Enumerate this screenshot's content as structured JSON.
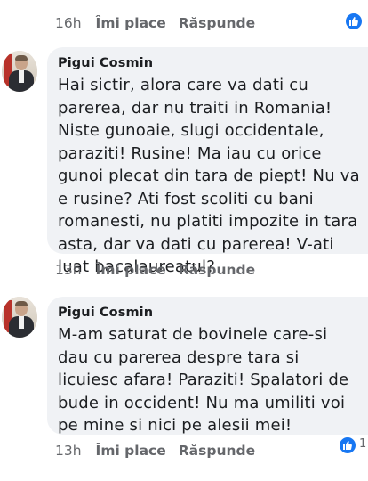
{
  "top_actions": {
    "time": "16h",
    "like": "Îmi place",
    "reply": "Răspunde"
  },
  "comments": [
    {
      "author": "Pigui Cosmin",
      "text": "Hai sictir, alora care va dati cu parerea, dar nu traiti in Romania! Niste gunoaie, slugi occidentale, paraziti! Rusine! Ma iau cu orice gunoi plecat din tara de piept! Nu va e rusine? Ati fost scoliti cu bani romanesti, nu platiti impozite in tara asta, dar va dati cu parerea! V-ati luat bacalaureatul?",
      "time": "13h",
      "like": "Îmi place",
      "reply": "Răspunde"
    },
    {
      "author": "Pigui Cosmin",
      "text": "M-am saturat de bovinele care-si dau cu parerea despre tara si licuiesc afara! Paraziti! Spalatori de bude in occident! Nu ma umiliti voi pe mine si nici pe alesii mei!",
      "time": "13h",
      "like": "Îmi place",
      "reply": "Răspunde",
      "reaction_count": "1"
    }
  ],
  "colors": {
    "bubble": "#f0f2f5",
    "meta": "#65676b",
    "like_blue": "#1877f2"
  }
}
